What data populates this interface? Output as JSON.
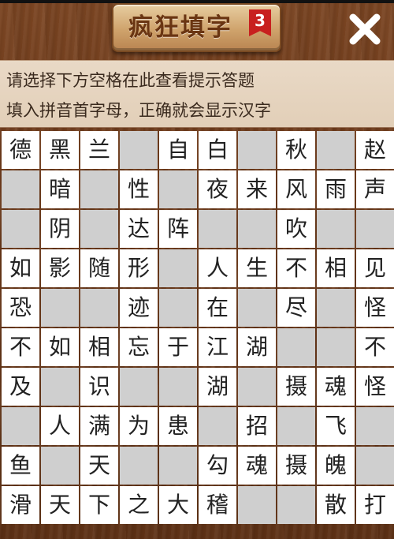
{
  "header": {
    "title": "疯狂填字",
    "level": "3"
  },
  "hints": {
    "line1": "请选择下方空格在此查看提示答题",
    "line2": "填入拼音首字母，正确就会显示汉字"
  },
  "colors": {
    "wood": "#6e3d1c",
    "plaque": "#d7b07a",
    "badge": "#c8201f",
    "cell_white": "#ffffff",
    "cell_gray": "#cfcfcf"
  },
  "icons": {
    "close": "close-x-icon"
  },
  "grid": [
    [
      "德",
      "黑",
      "兰",
      "#",
      "自",
      "白",
      "#",
      "秋",
      "#",
      "赵"
    ],
    [
      "#",
      "暗",
      "#",
      "性",
      "#",
      "夜",
      "来",
      "风",
      "雨",
      "声"
    ],
    [
      "#",
      "阴",
      "#",
      "达",
      "阵",
      "#",
      "#",
      "吹",
      "#",
      "#"
    ],
    [
      "如",
      "影",
      "随",
      "形",
      "#",
      "人",
      "生",
      "不",
      "相",
      "见"
    ],
    [
      "恐",
      "#",
      "#",
      "迹",
      "#",
      "在",
      "#",
      "尽",
      "#",
      "怪"
    ],
    [
      "不",
      "如",
      "相",
      "忘",
      "于",
      "江",
      "湖",
      "#",
      "#",
      "不"
    ],
    [
      "及",
      "#",
      "识",
      "#",
      "#",
      "湖",
      "#",
      "摄",
      "魂",
      "怪"
    ],
    [
      "#",
      "人",
      "满",
      "为",
      "患",
      "#",
      "招",
      "#",
      "飞",
      "#"
    ],
    [
      "鱼",
      "#",
      "天",
      "#",
      "#",
      "勾",
      "魂",
      "摄",
      "魄",
      "#"
    ],
    [
      "滑",
      "天",
      "下",
      "之",
      "大",
      "稽",
      "#",
      "#",
      "散",
      "打"
    ]
  ]
}
